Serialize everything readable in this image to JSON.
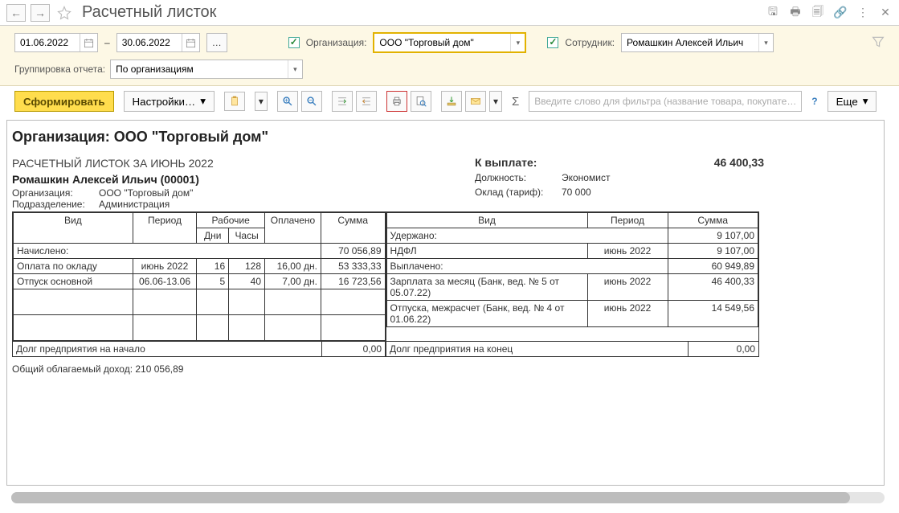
{
  "title": "Расчетный листок",
  "dates": {
    "from": "01.06.2022",
    "to": "30.06.2022",
    "sep": "–"
  },
  "org_filter": {
    "label": "Организация:",
    "value": "ООО \"Торговый дом\""
  },
  "emp_filter": {
    "label": "Сотрудник:",
    "value": "Ромашкин Алексей Ильич"
  },
  "grouping": {
    "label": "Группировка отчета:",
    "value": "По организациям"
  },
  "toolbar": {
    "form": "Сформировать",
    "settings": "Настройки…",
    "search_placeholder": "Введите слово для фильтра (название товара, покупате…",
    "sigma": "Σ",
    "q": "?",
    "more": "Еще"
  },
  "report": {
    "org_header": "Организация: ООО \"Торговый дом\"",
    "period_header": "РАСЧЕТНЫЙ ЛИСТОК ЗА ИЮНЬ 2022",
    "employee_header": "Ромашкин Алексей Ильич (00001)",
    "meta_left": [
      {
        "l": "Организация:",
        "v": "ООО \"Торговый дом\""
      },
      {
        "l": "Подразделение:",
        "v": "Администрация"
      }
    ],
    "pay_label": "К выплате:",
    "pay_value": "46 400,33",
    "meta_right": [
      {
        "l": "Должность:",
        "v": "Экономист"
      },
      {
        "l": "Оклад (тариф):",
        "v": "70 000"
      }
    ],
    "hdr": {
      "vid": "Вид",
      "period": "Период",
      "rab": "Рабочие",
      "dni": "Дни",
      "chasy": "Часы",
      "opl": "Оплачено",
      "summa": "Сумма"
    },
    "accrued": {
      "title": "Начислено:",
      "total": "70 056,89",
      "rows": [
        {
          "vid": "Оплата по окладу",
          "period": "июнь 2022",
          "dni": "16",
          "chasy": "128",
          "opl": "16,00 дн.",
          "sum": "53 333,33"
        },
        {
          "vid": "Отпуск основной",
          "period": "06.06-13.06",
          "dni": "5",
          "chasy": "40",
          "opl": "7,00 дн.",
          "sum": "16 723,56"
        }
      ]
    },
    "withheld": {
      "title": "Удержано:",
      "total": "9 107,00",
      "rows": [
        {
          "vid": "НДФЛ",
          "period": "июнь 2022",
          "sum": "9 107,00"
        }
      ]
    },
    "paid": {
      "title": "Выплачено:",
      "total": "60 949,89",
      "rows": [
        {
          "vid": "Зарплата за месяц (Банк, вед. № 5 от 05.07.22)",
          "period": "июнь 2022",
          "sum": "46 400,33"
        },
        {
          "vid": "Отпуска, межрасчет (Банк, вед. № 4 от 01.06.22)",
          "period": "июнь 2022",
          "sum": "14 549,56"
        }
      ]
    },
    "debt_start_l": "Долг предприятия на начало",
    "debt_start_v": "0,00",
    "debt_end_l": "Долг предприятия на конец",
    "debt_end_v": "0,00",
    "taxable": "Общий облагаемый доход: 210 056,89"
  }
}
